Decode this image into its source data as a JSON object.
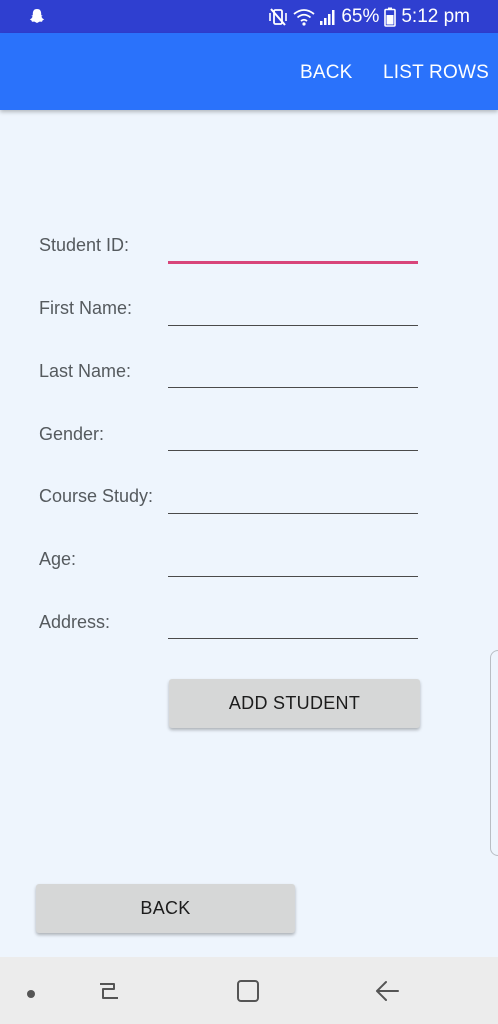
{
  "status_bar": {
    "battery": "65%",
    "time": "5:12 pm",
    "icons": [
      "snapchat-icon",
      "mute-vibrate-icon",
      "wifi-icon",
      "signal-icon",
      "battery-icon"
    ]
  },
  "app_bar": {
    "back_label": "BACK",
    "list_rows_label": "LIST ROWS",
    "color": "#2a72fb"
  },
  "form": {
    "fields": [
      {
        "label": "Student ID:",
        "value": "",
        "focused": true
      },
      {
        "label": "First Name:",
        "value": ""
      },
      {
        "label": "Last Name:",
        "value": ""
      },
      {
        "label": "Gender:",
        "value": ""
      },
      {
        "label": "Course Study:",
        "value": ""
      },
      {
        "label": "Age:",
        "value": ""
      },
      {
        "label": "Address:",
        "value": ""
      }
    ],
    "add_button_label": "ADD STUDENT",
    "focus_color": "#d8457a"
  },
  "footer": {
    "back_button_label": "BACK"
  },
  "nav_bar": {
    "icons": [
      "dot-icon",
      "recent-apps-icon",
      "home-icon",
      "back-arrow-icon"
    ]
  }
}
